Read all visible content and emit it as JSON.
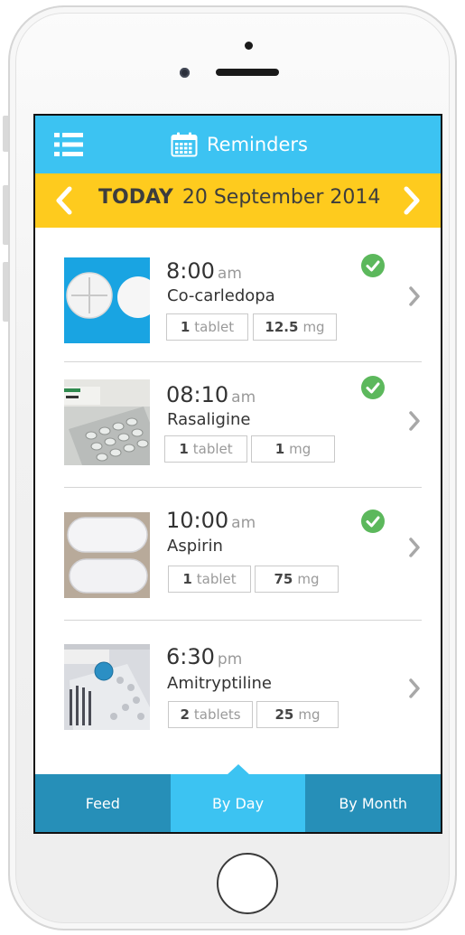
{
  "header": {
    "title": "Reminders",
    "menu_icon": "list-icon",
    "title_icon": "calendar-icon"
  },
  "date_bar": {
    "today_label": "TODAY",
    "date": "20 September 2014",
    "prev_icon": "chevron-left-icon",
    "next_icon": "chevron-right-icon"
  },
  "reminders": [
    {
      "time": "8:00",
      "period": "am",
      "name": "Co-carledopa",
      "quantity": "1",
      "quantity_unit": "tablet",
      "dose": "12.5",
      "dose_unit": "mg",
      "taken": true
    },
    {
      "time": "08:10",
      "period": "am",
      "name": "Rasaligine",
      "quantity": "1",
      "quantity_unit": "tablet",
      "dose": "1",
      "dose_unit": "mg",
      "taken": true
    },
    {
      "time": "10:00",
      "period": "am",
      "name": "Aspirin",
      "quantity": "1",
      "quantity_unit": "tablet",
      "dose": "75",
      "dose_unit": "mg",
      "taken": true
    },
    {
      "time": "6:30",
      "period": "pm",
      "name": "Amitryptiline",
      "quantity": "2",
      "quantity_unit": "tablets",
      "dose": "25",
      "dose_unit": "mg",
      "taken": false
    }
  ],
  "tabs": [
    {
      "label": "Feed",
      "active": false
    },
    {
      "label": "By Day",
      "active": true
    },
    {
      "label": "By Month",
      "active": false
    }
  ],
  "colors": {
    "header": "#3cc3f2",
    "date_bar": "#fecb1e",
    "tab_bar": "#268fb8",
    "tab_active": "#3cc3f2",
    "check": "#5cb85c"
  }
}
